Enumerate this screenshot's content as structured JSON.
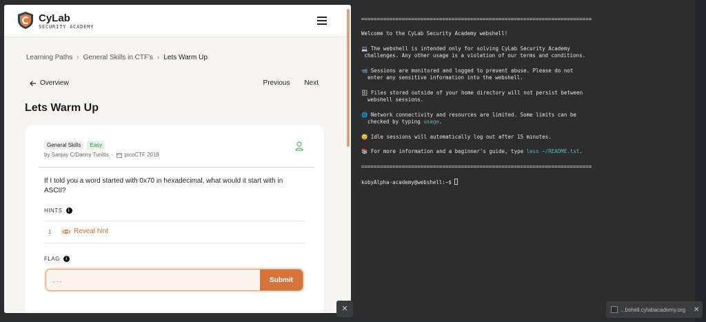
{
  "app": {
    "brand_name": "CyLab",
    "brand_sub": "SECURITY ACADEMY",
    "brand_color": "#c96a2a"
  },
  "breadcrumb": [
    "Learning Paths",
    "General Skills in CTF's",
    "Lets Warm Up"
  ],
  "nav": {
    "overview": "Overview",
    "previous": "Previous",
    "next": "Next"
  },
  "challenge": {
    "title": "Lets Warm Up",
    "category": "General Skills",
    "difficulty": "Easy",
    "authors": "by Sanjay C/Danny Tunitis",
    "event": "picoCTF 2019",
    "question": "If I told you a word started with 0x70 in hexadecimal, what would it start with in ASCII?",
    "hints_label": "HINTS",
    "hints": [
      {
        "num": "1",
        "label": "Reveal hint"
      }
    ],
    "flag_label": "FLAG",
    "flag_placeholder": "...",
    "submit_label": "Submit"
  },
  "terminal": {
    "separator": "==========================================================================",
    "welcome": "Welcome to the CyLab Security Academy webshell!",
    "lines": [
      {
        "icon": "💻",
        "text": " The webshell is intended only for solving CyLab Security Academy",
        "cont": " challenges. Any other usage is a violation of our terms and conditions."
      },
      {
        "icon": "📹",
        "text": " Sessions are monitored and logged to prevent abuse. Please do not",
        "cont": "  enter any sensitive information into the webshell."
      },
      {
        "icon": "🗄",
        "text": " Files stored outside of your home directory will not persist between",
        "cont": "  webshell sessions."
      },
      {
        "icon": "🌐",
        "text": " Network connectivity and resources are limited. Some limits can be",
        "cont_pre": "  checked by typing ",
        "cont_link": "usage",
        "cont_post": "."
      },
      {
        "icon": "😴",
        "text": " Idle sessions will automatically log out after 15 minutes."
      },
      {
        "icon": "📚",
        "text_pre": " For more information and a beginner's guide, type ",
        "text_link": "less ~/README.txt",
        "text_post": "."
      }
    ],
    "prompt": "kobyAlpha-academy@webshell:~$ "
  },
  "tab": {
    "label": "...bshell.cylabacademy.org"
  }
}
